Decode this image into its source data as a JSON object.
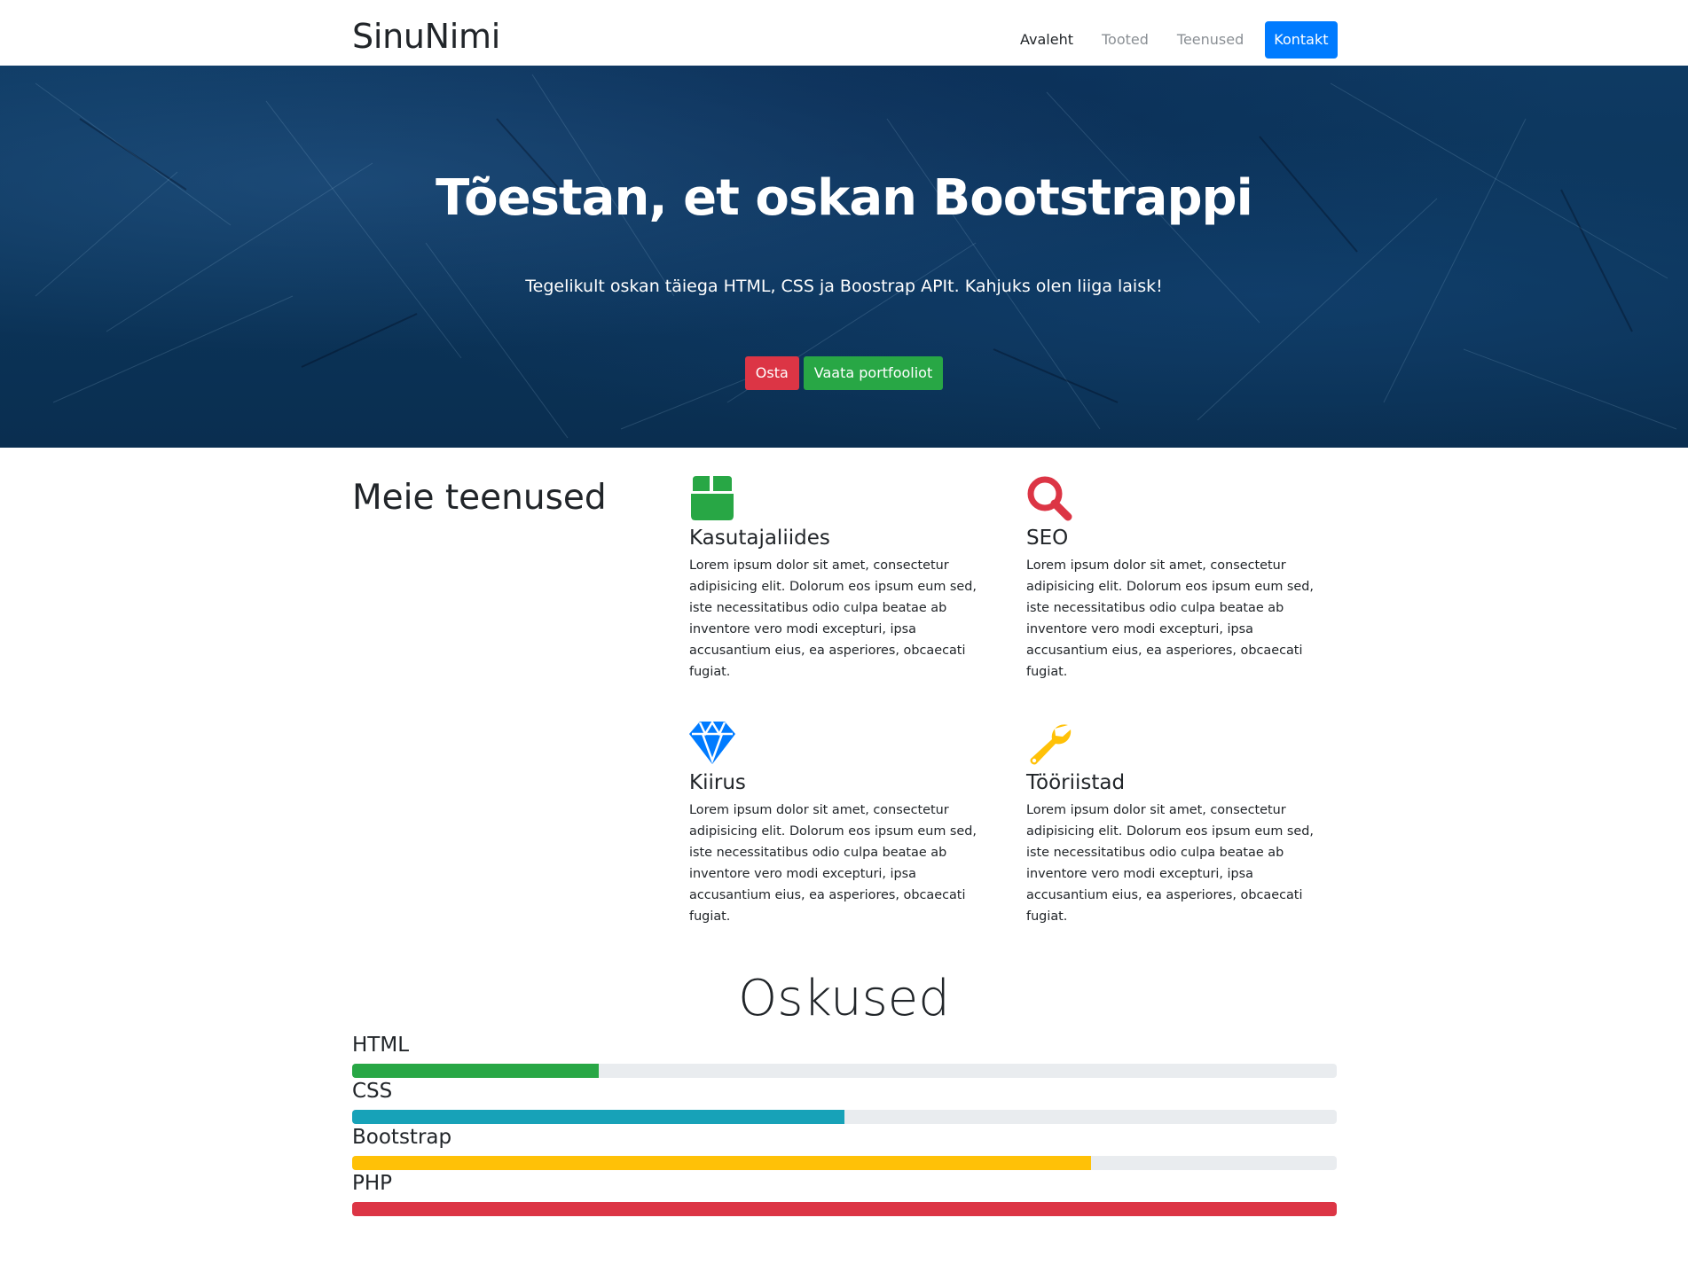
{
  "navbar": {
    "brand": "SinuNimi",
    "links": [
      {
        "label": "Avaleht"
      },
      {
        "label": "Tooted"
      },
      {
        "label": "Teenused"
      },
      {
        "label": "Kontakt"
      }
    ]
  },
  "hero": {
    "title": "Tõestan, et oskan Bootstrappi",
    "subtitle": "Tegelikult oskan täiega HTML, CSS ja Boostrap APIt. Kahjuks olen liiga laisk!",
    "buttons": {
      "buy": "Osta",
      "portfolio": "Vaata portfooliot"
    }
  },
  "services": {
    "heading": "Meie teenused",
    "items": [
      {
        "title": "Kasutajaliides",
        "icon": "box-icon",
        "icon_color": "#28a745",
        "text": "Lorem ipsum dolor sit amet, consectetur adipisicing elit. Dolorum eos ipsum eum sed, iste necessitatibus odio culpa beatae ab inventore vero modi excepturi, ipsa accusantium eius, ea asperiores, obcaecati fugiat."
      },
      {
        "title": "SEO",
        "icon": "search-icon",
        "icon_color": "#dc3545",
        "text": "Lorem ipsum dolor sit amet, consectetur adipisicing elit. Dolorum eos ipsum eum sed, iste necessitatibus odio culpa beatae ab inventore vero modi excepturi, ipsa accusantium eius, ea asperiores, obcaecati fugiat."
      },
      {
        "title": "Kiirus",
        "icon": "gem-icon",
        "icon_color": "#007bff",
        "text": "Lorem ipsum dolor sit amet, consectetur adipisicing elit. Dolorum eos ipsum eum sed, iste necessitatibus odio culpa beatae ab inventore vero modi excepturi, ipsa accusantium eius, ea asperiores, obcaecati fugiat."
      },
      {
        "title": "Tööriistad",
        "icon": "wrench-icon",
        "icon_color": "#ffc107",
        "text": "Lorem ipsum dolor sit amet, consectetur adipisicing elit. Dolorum eos ipsum eum sed, iste necessitatibus odio culpa beatae ab inventore vero modi excepturi, ipsa accusantium eius, ea asperiores, obcaecati fugiat."
      }
    ]
  },
  "skills": {
    "title": "Oskused",
    "items": [
      {
        "label": "HTML",
        "percent": 25,
        "color": "#28a745"
      },
      {
        "label": "CSS",
        "percent": 50,
        "color": "#17a2b8"
      },
      {
        "label": "Bootstrap",
        "percent": 75,
        "color": "#ffc107"
      },
      {
        "label": "PHP",
        "percent": 100,
        "color": "#dc3545"
      }
    ]
  }
}
